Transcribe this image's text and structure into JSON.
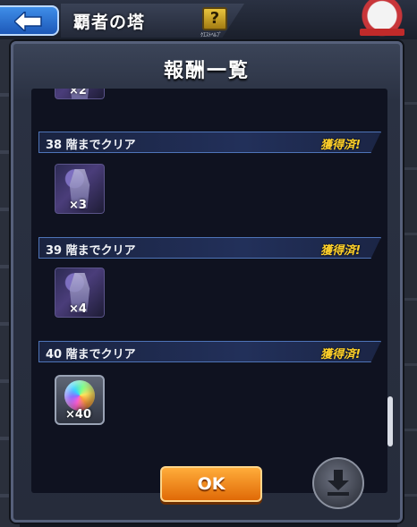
{
  "header": {
    "title": "覇者の塔",
    "help_caption": "ｸｴｽﾄﾍﾙﾌﾟ"
  },
  "modal": {
    "title": "報酬一覧",
    "ok_label": "OK"
  },
  "rewards": [
    {
      "label": "",
      "status": "",
      "quantity": "×2"
    },
    {
      "label": "38 階までクリア",
      "status": "獲得済!",
      "quantity": "×3"
    },
    {
      "label": "39 階までクリア",
      "status": "獲得済!",
      "quantity": "×4"
    },
    {
      "label": "40 階までクリア",
      "status": "獲得済!",
      "quantity": "×40"
    }
  ]
}
